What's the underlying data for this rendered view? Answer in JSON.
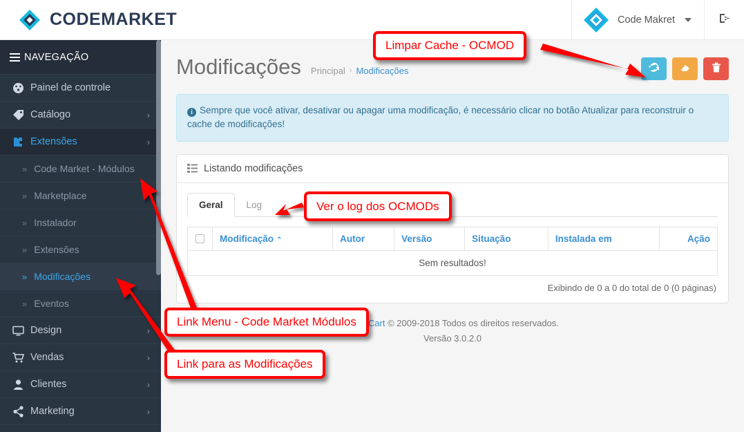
{
  "header": {
    "brand_name": "CODEMARKET",
    "brand_icon": "diamond-logo-icon",
    "user_name": "Code Makret",
    "user_icon": "diamond-avatar-icon",
    "logout_icon": "logout-icon",
    "caret_icon": "chevron-down-icon"
  },
  "sidebar": {
    "title": "NAVEGAÇÃO",
    "menu_icon": "hamburger-icon",
    "items": [
      {
        "label": "Painel de controle",
        "icon": "dashboard-icon",
        "arrow": "",
        "active": false,
        "sub": false
      },
      {
        "label": "Catálogo",
        "icon": "tag-icon",
        "arrow": "›",
        "active": false,
        "sub": false
      },
      {
        "label": "Extensões",
        "icon": "puzzle-icon",
        "arrow": "›",
        "active": true,
        "sub": false
      },
      {
        "label": "Code Market - Módulos",
        "icon": "chevron-double-right-icon",
        "arrow": "",
        "active": false,
        "sub": true
      },
      {
        "label": "Marketplace",
        "icon": "chevron-double-right-icon",
        "arrow": "",
        "active": false,
        "sub": true
      },
      {
        "label": "Instalador",
        "icon": "chevron-double-right-icon",
        "arrow": "",
        "active": false,
        "sub": true
      },
      {
        "label": "Extensões",
        "icon": "chevron-double-right-icon",
        "arrow": "",
        "active": false,
        "sub": true
      },
      {
        "label": "Modificações",
        "icon": "chevron-double-right-icon",
        "arrow": "",
        "active": true,
        "sub": true
      },
      {
        "label": "Eventos",
        "icon": "chevron-double-right-icon",
        "arrow": "",
        "active": false,
        "sub": true
      },
      {
        "label": "Design",
        "icon": "monitor-icon",
        "arrow": "›",
        "active": false,
        "sub": false
      },
      {
        "label": "Vendas",
        "icon": "cart-icon",
        "arrow": "›",
        "active": false,
        "sub": false
      },
      {
        "label": "Clientes",
        "icon": "user-icon",
        "arrow": "›",
        "active": false,
        "sub": false
      },
      {
        "label": "Marketing",
        "icon": "share-icon",
        "arrow": "›",
        "active": false,
        "sub": false
      }
    ]
  },
  "page": {
    "title": "Modificações",
    "breadcrumb": {
      "home": "Principal",
      "separator": "›",
      "current": "Modificações"
    },
    "actions": [
      {
        "name": "refresh-button",
        "icon": "refresh-icon",
        "color": "#4ebbdd"
      },
      {
        "name": "clear-cache-button",
        "icon": "eraser-icon",
        "color": "#f2a945"
      },
      {
        "name": "delete-button",
        "icon": "trash-icon",
        "color": "#e8574a"
      }
    ],
    "alert": "Sempre que você ativar, desativar ou apagar uma modificação, é necessário clicar no botão Atualizar para reconstruir o cache de modificações!",
    "alert_icon": "info-icon"
  },
  "panel": {
    "heading": "Listando modificações",
    "heading_icon": "list-icon",
    "tabs": [
      {
        "label": "Geral",
        "active": true
      },
      {
        "label": "Log",
        "active": false
      }
    ],
    "table": {
      "columns": [
        "Modificação",
        "Autor",
        "Versão",
        "Situação",
        "Instalada em",
        "Ação"
      ],
      "sort_column": "Modificação",
      "sort_caret": "⌃",
      "empty_message": "Sem resultados!",
      "rows": []
    },
    "pagination": "Exibindo de 0 a 0 do total de 0 (0 páginas)"
  },
  "footer": {
    "link_text": "OpenCart",
    "copyright": "© 2009-2018 Todos os direitos reservados.",
    "version": "Versão 3.0.2.0"
  },
  "annotations": [
    {
      "id": "anno-limpar-cache",
      "text": "Limpar Cache - OCMOD"
    },
    {
      "id": "anno-ver-log",
      "text": "Ver o log dos OCMODs"
    },
    {
      "id": "anno-link-menu",
      "text": "Link Menu - Code Market Módulos"
    },
    {
      "id": "anno-link-modificacoes",
      "text": "Link para as Modificações"
    }
  ],
  "colors": {
    "accent_blue": "#3a8fd4",
    "sidebar_bg": "#2a3542",
    "annotation_red": "#ff0000",
    "brand_navy": "#2b3a55",
    "brand_cyan": "#16b8e0"
  }
}
